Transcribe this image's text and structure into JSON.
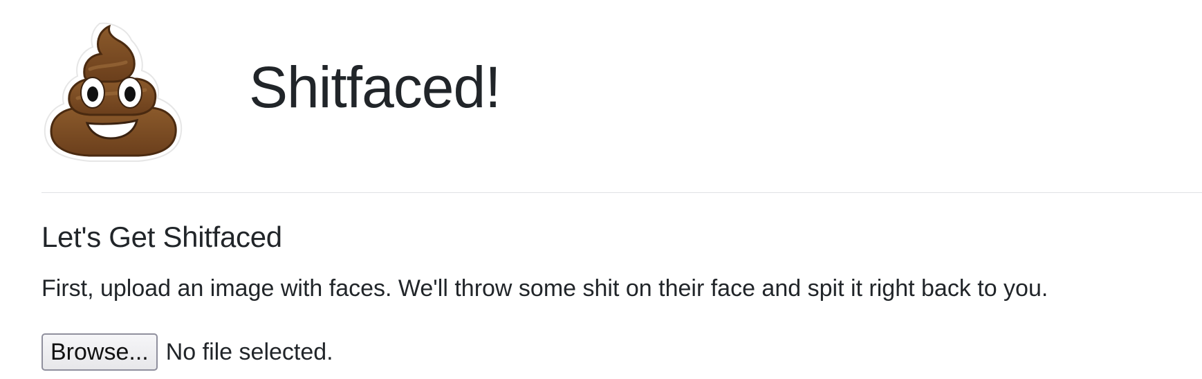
{
  "header": {
    "title": "Shitfaced!",
    "logo_icon": "pile-of-poo-emoji"
  },
  "section": {
    "title": "Let's Get Shitfaced",
    "description": "First, upload an image with faces. We'll throw some shit on their face and spit it right back to you."
  },
  "upload": {
    "browse_label": "Browse...",
    "status_text": "No file selected."
  },
  "colors": {
    "text": "#212529",
    "divider": "#dfe1e4",
    "poo_brown": "#7a4a23",
    "poo_outline": "#4a2a10"
  }
}
